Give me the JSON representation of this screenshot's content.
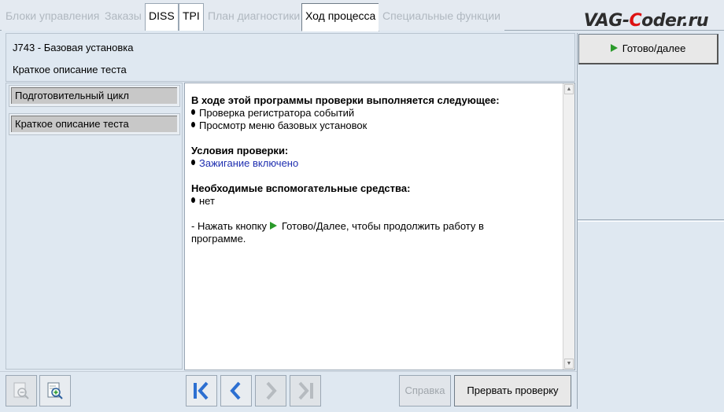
{
  "tabs": [
    {
      "label": "Блоки управления",
      "state": "disabled"
    },
    {
      "label": "Заказы",
      "state": "disabled"
    },
    {
      "label": "DISS",
      "state": "enabled"
    },
    {
      "label": "TPI",
      "state": "enabled"
    },
    {
      "label": "План диагностики",
      "state": "disabled"
    },
    {
      "label": "Ход процесса",
      "state": "active"
    },
    {
      "label": "Специальные функции",
      "state": "disabled"
    }
  ],
  "watermark": {
    "part1": "VAG-",
    "part2": "C",
    "part3": "oder.ru"
  },
  "header": {
    "title": "J743 - Базовая установка",
    "subtitle": "Краткое описание теста"
  },
  "steps": [
    {
      "label": "Подготовительный цикл"
    },
    {
      "label": "Краткое описание теста"
    }
  ],
  "content": {
    "section1": {
      "heading": "В ходе этой программы проверки выполняется следующее:",
      "items": [
        "Проверка регистратора событий",
        "Просмотр меню базовых установок"
      ]
    },
    "section2": {
      "heading": "Условия проверки:",
      "items": [
        "Зажигание включено"
      ]
    },
    "section3": {
      "heading": "Необходимые вспомогательные средства:",
      "items": [
        "нет"
      ]
    },
    "instruction": {
      "before": "- Нажать кнопку",
      "after": "Готово/Далее, чтобы продолжить работу в",
      "line2": "программе."
    }
  },
  "right": {
    "go_label": "Готово/далее"
  },
  "toolbar": {
    "help_label": "Справка",
    "abort_label": "Прервать проверку",
    "icons": [
      "zoom-out-icon",
      "zoom-in-icon",
      "first-icon",
      "previous-icon",
      "next-icon",
      "last-icon"
    ]
  },
  "colors": {
    "background": "#dfe8f1",
    "accent_green": "#2a9a2a",
    "link_blue": "#1f2fb0",
    "nav_blue": "#2c6fd1",
    "watermark_red": "#dd1111"
  }
}
